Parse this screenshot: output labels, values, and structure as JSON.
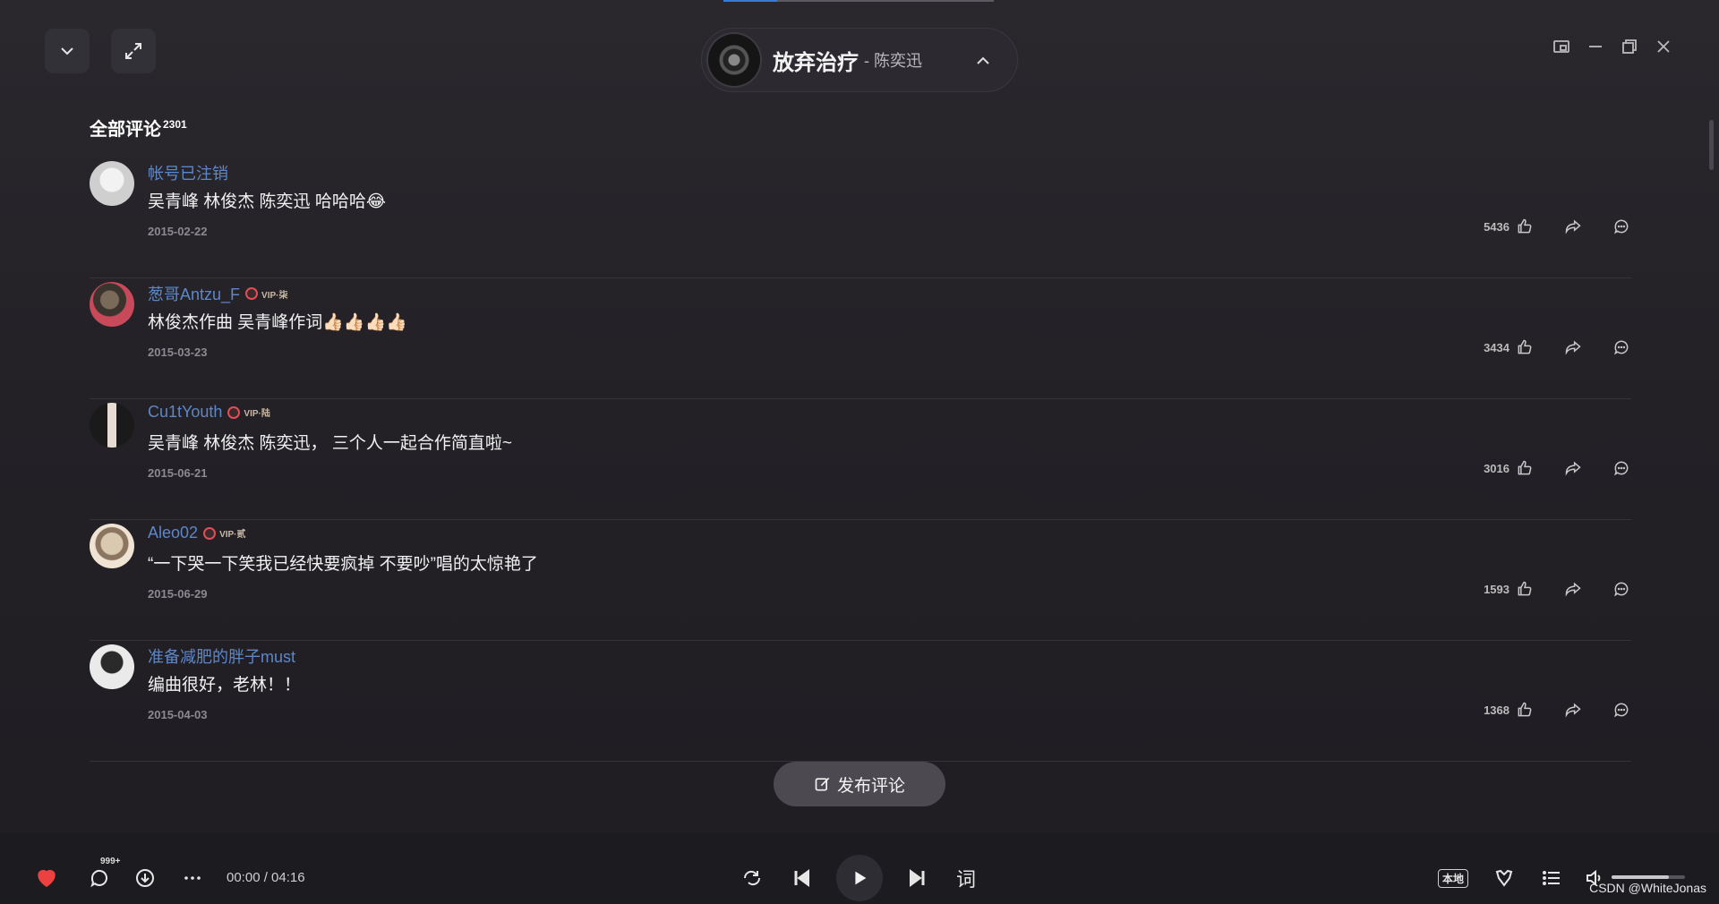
{
  "header": {
    "collapse_icon": "chevron-down-icon",
    "expand_icon": "expand-icon",
    "song_title": "放弃治疗",
    "song_artist": "- 陈奕迅",
    "window_icons": [
      "mini-mode-icon",
      "minimize-icon",
      "restore-icon",
      "close-icon"
    ]
  },
  "comments_section": {
    "title": "全部评论",
    "count": "2301"
  },
  "comments": [
    {
      "user": "帐号已注销",
      "vip": "",
      "text": "吴青峰 林俊杰 陈奕迅 哈哈哈😂",
      "date": "2015-02-22",
      "likes": "5436"
    },
    {
      "user": "葱哥Antzu_F",
      "vip": "VIP·柒",
      "text": "林俊杰作曲 吴青峰作词👍🏻👍🏻👍🏻👍🏻",
      "date": "2015-03-23",
      "likes": "3434"
    },
    {
      "user": "Cu1tYouth",
      "vip": "VIP·陆",
      "text": "吴青峰 林俊杰 陈奕迅， 三个人一起合作简直啦~",
      "date": "2015-06-21",
      "likes": "3016"
    },
    {
      "user": "Aleo02",
      "vip": "VIP·贰",
      "text": "“一下哭一下笑我已经快要疯掉 不要吵”唱的太惊艳了",
      "date": "2015-06-29",
      "likes": "1593"
    },
    {
      "user": "准备减肥的胖子must",
      "vip": "",
      "text": "编曲很好，老林！！",
      "date": "2015-04-03",
      "likes": "1368"
    }
  ],
  "publish_button": {
    "label": "发布评论"
  },
  "player": {
    "comment_badge": "999+",
    "time": "00:00 / 04:16",
    "lyrics_label": "词",
    "local_label": "本地",
    "volume": 0.78,
    "watermark": "CSDN @WhiteJonas"
  },
  "colors": {
    "accent_like": "#ec4141",
    "username": "#5d87c8"
  }
}
